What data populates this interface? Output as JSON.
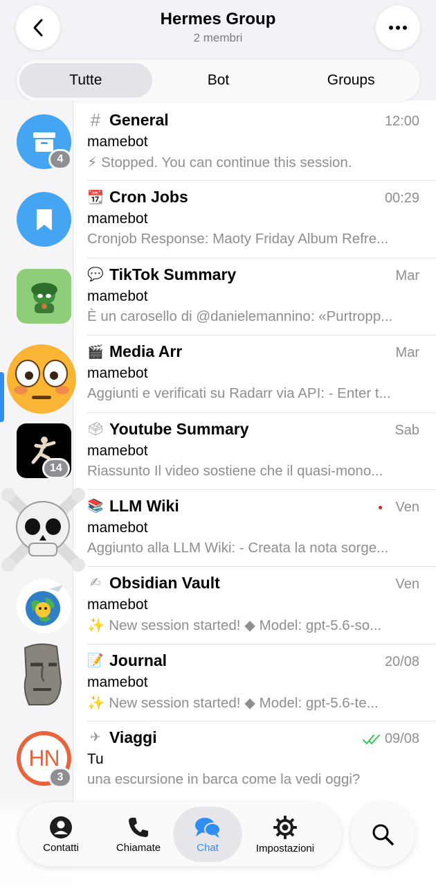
{
  "header": {
    "title": "Hermes Group",
    "subtitle": "2 membri"
  },
  "tabs": [
    "Tutte",
    "Bot",
    "Groups"
  ],
  "folders": [
    {
      "icon": "archive-icon",
      "badge": "4"
    },
    {
      "icon": "bookmark-icon",
      "badge": ""
    },
    {
      "icon": "frog-avatar",
      "badge": ""
    },
    {
      "icon": "flushed-face-emoji",
      "badge": ""
    },
    {
      "icon": "runner-avatar",
      "badge": "14"
    },
    {
      "icon": "skull-crossbones-emoji",
      "badge": ""
    },
    {
      "icon": "globe-traveler-avatar",
      "badge": ""
    },
    {
      "icon": "moai-emoji",
      "badge": ""
    },
    {
      "icon": "hn-logo-avatar",
      "badge": "3"
    }
  ],
  "chats": [
    {
      "emoji": "#",
      "title": "General",
      "time": "12:00",
      "sender": "mamebot",
      "preview": "⚡ Stopped. You can continue this session."
    },
    {
      "emoji": "📆",
      "title": "Cron Jobs",
      "time": "00:29",
      "sender": "mamebot",
      "preview": "Cronjob Response: Maoty Friday Album Refre..."
    },
    {
      "emoji": "💬",
      "title": "TikTok Summary",
      "time": "Mar",
      "sender": "mamebot",
      "preview": "È un carosello di @danielemannino: «Purtropp..."
    },
    {
      "emoji": "🎬",
      "title": "Media Arr",
      "time": "Mar",
      "sender": "mamebot",
      "preview": "Aggiunti e verificati su Radarr via API: - Enter t..."
    },
    {
      "emoji": "🗳",
      "title": "Youtube Summary",
      "time": "Sab",
      "sender": "mamebot",
      "preview": "Riassunto Il video sostiene che il quasi-mono..."
    },
    {
      "emoji": "📚",
      "title": "LLM Wiki",
      "time": "Ven",
      "sender": "mamebot",
      "preview": "Aggiunto alla LLM Wiki: - Creata la nota sorge..."
    },
    {
      "emoji": "✍",
      "title": "Obsidian Vault",
      "time": "Ven",
      "sender": "mamebot",
      "preview": "✨ New session started! ◆ Model: gpt-5.6-so..."
    },
    {
      "emoji": "📝",
      "title": "Journal",
      "time": "20/08",
      "sender": "mamebot",
      "preview": "✨ New session started! ◆ Model: gpt-5.6-te..."
    },
    {
      "emoji": "✈",
      "title": "Viaggi",
      "time": "09/08",
      "sender": "Tu",
      "preview": "una escursione in barca come la vedi oggi?"
    }
  ],
  "tabbar": {
    "contacts": "Contatti",
    "calls": "Chiamate",
    "chat": "Chat",
    "settings": "Impostazioni"
  },
  "colors": {
    "accent": "#2f8ef0",
    "read_check": "#34c759",
    "unread_dot": "#e0211d"
  }
}
